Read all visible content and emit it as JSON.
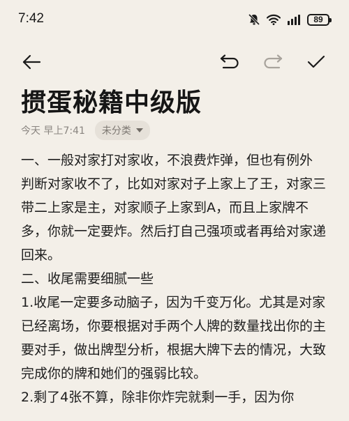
{
  "status": {
    "time": "7:42",
    "battery": "89",
    "icons": [
      "bell-off-icon",
      "wifi-icon",
      "signal-icon",
      "battery-icon"
    ]
  },
  "toolbar": {
    "icons": [
      "back-arrow-icon",
      "undo-icon",
      "redo-icon",
      "checkmark-icon"
    ]
  },
  "note": {
    "title": "掼蛋秘籍中级版",
    "date": "今天 早上7:41",
    "category": "未分类",
    "paragraphs": [
      "一、一般对家打对家收，不浪费炸弹，但也有例外",
      "判断对家收不了，比如对家对子上家上了王，对家三带二上家是主，对家顺子上家到A，而且上家牌不多，你就一定要炸。然后打自己强项或者再给对家递回来。",
      "二、收尾需要细腻一些",
      "1.收尾一定要多动脑子，因为千变万化。尤其是对家已经离场，你要根据对手两个人牌的数量找出你的主要对手，做出牌型分析，根据大牌下去的情况，大致完成你的牌和她们的强弱比较。",
      "2.剩了4张不算，除非你炸完就剩一手，因为你"
    ]
  },
  "colors": {
    "background": "#f3efe8",
    "text": "#1e1e1e",
    "meta": "#8a8580",
    "chip": "#e6e1d9",
    "disabled_icon": "#a8a39c"
  }
}
